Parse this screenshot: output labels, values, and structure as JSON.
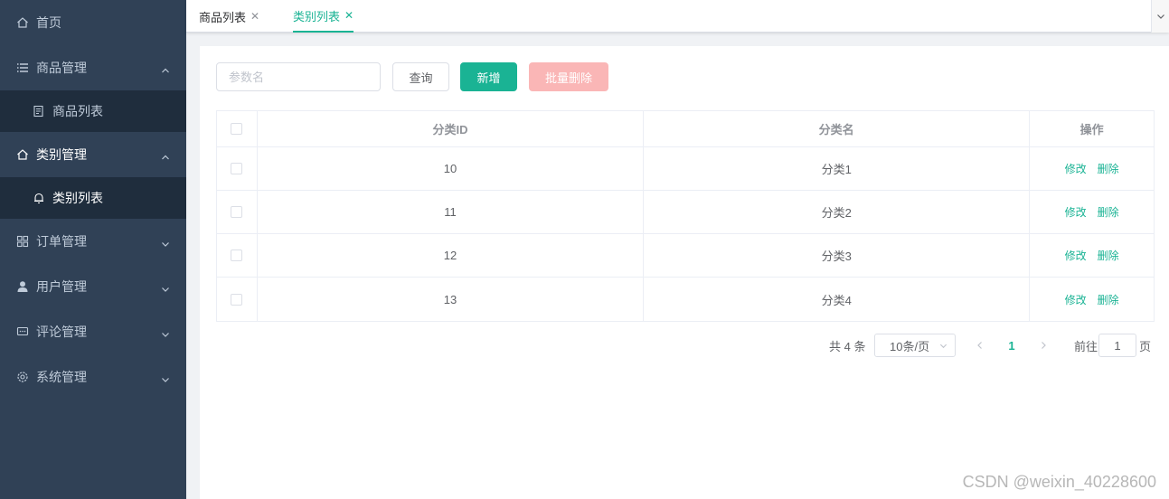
{
  "sidebar": {
    "home": {
      "label": "首页",
      "icon": "home-icon"
    },
    "product_mgmt": {
      "label": "商品管理",
      "icon": "list-icon"
    },
    "product_list": {
      "label": "商品列表",
      "icon": "document-icon"
    },
    "category_mgmt": {
      "label": "类别管理",
      "icon": "home-icon"
    },
    "category_list": {
      "label": "类别列表",
      "icon": "bell-icon"
    },
    "order_mgmt": {
      "label": "订单管理",
      "icon": "grid-icon"
    },
    "user_mgmt": {
      "label": "用户管理",
      "icon": "user-icon"
    },
    "comment_mgmt": {
      "label": "评论管理",
      "icon": "chat-icon"
    },
    "system_mgmt": {
      "label": "系统管理",
      "icon": "gear-icon"
    }
  },
  "tabs": [
    {
      "label": "商品列表",
      "active": false
    },
    {
      "label": "类别列表",
      "active": true
    }
  ],
  "toolbar": {
    "search_placeholder": "参数名",
    "query_label": "查询",
    "add_label": "新增",
    "batch_delete_label": "批量删除"
  },
  "table": {
    "headers": {
      "id": "分类ID",
      "name": "分类名",
      "ops": "操作"
    },
    "rows": [
      {
        "id": "10",
        "name": "分类1"
      },
      {
        "id": "11",
        "name": "分类2"
      },
      {
        "id": "12",
        "name": "分类3"
      },
      {
        "id": "13",
        "name": "分类4"
      }
    ],
    "edit_label": "修改",
    "delete_label": "删除"
  },
  "pagination": {
    "total_text": "共 4 条",
    "page_size": "10条/页",
    "current_page": "1",
    "goto_label": "前往",
    "goto_value": "1",
    "page_suffix": "页"
  },
  "watermark": "CSDN @weixin_40228600",
  "colors": {
    "sidebar_bg": "#304156",
    "submenu_bg": "#1f2d3d",
    "accent": "#1ab394",
    "danger_disabled": "#fab6b6"
  }
}
